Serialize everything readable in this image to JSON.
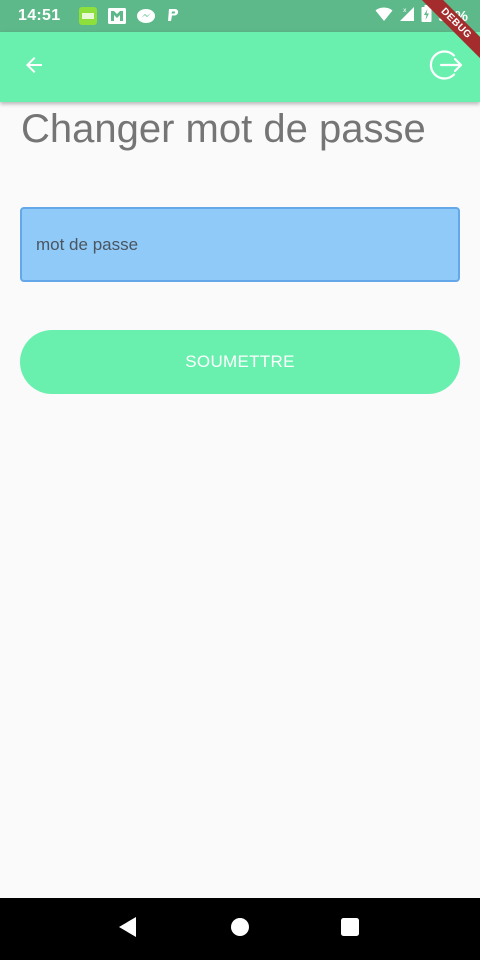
{
  "status_bar": {
    "time": "14:51",
    "battery_percent": "99%",
    "notification_icons": [
      "app-icon",
      "gmail-icon",
      "messenger-icon",
      "paypal-icon"
    ],
    "system_icons": [
      "wifi-icon",
      "signal-icon",
      "battery-icon"
    ]
  },
  "app_bar": {
    "background_color": "#69f0ae",
    "back_icon": "arrow-back-icon",
    "logout_icon": "logout-icon"
  },
  "debug_banner": {
    "label": "DEBUG"
  },
  "page": {
    "title": "Changer mot de passe"
  },
  "form": {
    "password_placeholder": "mot de passe",
    "password_value": "",
    "field_color": "#90caf9",
    "submit_label": "SOUMETTRE",
    "submit_color": "#69f0ae"
  },
  "nav_bar": {
    "items": [
      "back-icon",
      "home-icon",
      "recents-icon"
    ]
  }
}
